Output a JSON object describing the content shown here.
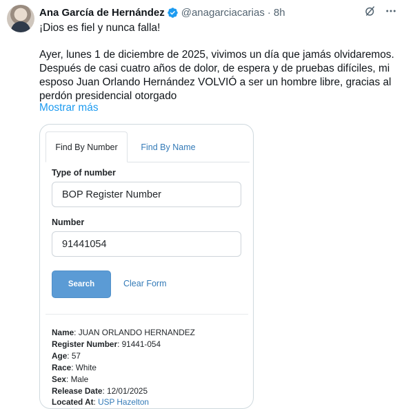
{
  "tweet": {
    "author_name": "Ana García de Hernández",
    "handle": "@anagarciacarias",
    "separator": "·",
    "time": "8h",
    "line1": "¡Dios es fiel y nunca falla!",
    "paragraph_line1": "Ayer, lunes 1 de diciembre de 2025, vivimos un día que jamás olvidaremos.",
    "paragraph_line2": "Después de casi cuatro años de dolor, de espera y de pruebas difíciles, mi",
    "paragraph_line3": "esposo Juan Orlando Hernández VOLVIÓ a ser un hombre libre, gracias al",
    "paragraph_line4": "perdón presidencial otorgado",
    "show_more": "Mostrar más"
  },
  "icons": {
    "verified": "verified-badge-icon",
    "grok": "grok-icon",
    "more": "more-icon"
  },
  "colors": {
    "link": "#1d9bf0",
    "verified": "#1d9bf0",
    "search_button": "#5b9bd5",
    "card_link": "#337ab7"
  },
  "form": {
    "tab_active": "Find By Number",
    "tab_other": "Find By Name",
    "type_label": "Type of number",
    "type_value": "BOP Register Number",
    "number_label": "Number",
    "number_value": "91441054",
    "search_button": "Search",
    "clear_link": "Clear Form"
  },
  "result": {
    "name_label": "Name",
    "name_value": "JUAN ORLANDO HERNANDEZ",
    "register_label": "Register Number",
    "register_value": "91441-054",
    "age_label": "Age",
    "age_value": "57",
    "race_label": "Race",
    "race_value": "White",
    "sex_label": "Sex",
    "sex_value": "Male",
    "release_label": "Release Date",
    "release_value": "12/01/2025",
    "located_label": "Located At",
    "located_value": "USP Hazelton"
  }
}
